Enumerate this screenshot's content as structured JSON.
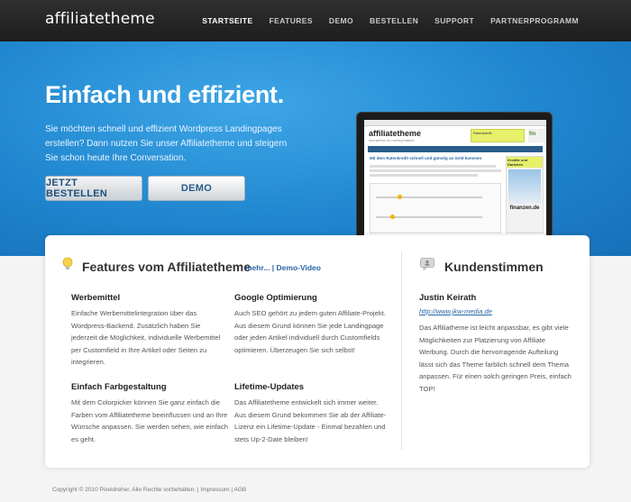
{
  "header": {
    "logo": "affiliatetheme",
    "nav": [
      "STARTSEITE",
      "FEATURES",
      "DEMO",
      "BESTELLEN",
      "SUPPORT",
      "PARTNERPROGRAMM"
    ]
  },
  "hero": {
    "title": "Einfach und effizient.",
    "text": "Sie möchten schnell und effizient Wordpress Landingpages erstellen? Dann nutzen Sie unser Affiliatetheme und steigern Sie schon heute Ihre Conversation.",
    "btn_order": "JETZT BESTELLEN",
    "btn_demo": "DEMO"
  },
  "laptop_screen": {
    "logo": "affiliatetheme",
    "sub": "wordpress for moneymakers",
    "ad": "Ratenkredit",
    "ad2": "fin",
    "headline": "Mit dem Ratenkredit schnell und günstig an Geld kommen",
    "side_header": "Kredite und Darlehen",
    "side_logo": "finanzen.de"
  },
  "features": {
    "title": "Features vom Affiliatetheme",
    "more_link": "mehr...",
    "separator": " | ",
    "demo_link": "Demo-Video",
    "items": [
      {
        "title": "Werbemittel",
        "text": "Einfache Werbemittelintegration über das Wordpress-Backend. Zusätzlich haben Sie jederzeit die Möglichkeit, individuelle Werbemittel per Customfield in Ihre Artikel oder Seiten zu integrieren."
      },
      {
        "title": "Google Optimierung",
        "text": "Auch SEO gehört zu jedem guten Affiliate-Projekt. Aus diesem Grund können Sie jede Landingpage oder jeden Artikel individuell durch Customfields optimieren. Überzeugen Sie sich selbst!"
      },
      {
        "title": "Einfach Farbgestaltung",
        "text": "Mit dem Colorpicker können Sie ganz einfach die Farben vom Affiliatetheme beeinflussen und an Ihre Wünsche anpassen. Sie werden sehen, wie einfach es geht."
      },
      {
        "title": "Lifetime-Updates",
        "text": "Das Affiliatetheme entwickelt sich immer weiter. Aus diesem Grund bekommen Sie ab der Affiliate-Lizenz ein Lifetime-Update - Einmal bezahlen und stets Up-2-Date bleiben!"
      }
    ]
  },
  "testimonials": {
    "title": "Kundenstimmen",
    "name": "Justin Keirath",
    "url": "http://www.jkw-media.de",
    "text": "Das Affiliatheme ist leicht anpassbar, es gibt viele Möglichkeiten zur Platzierung von Affiliate Werbung. Durch die hervorragende Aufteilung lässt sich das Theme farblich schnell dem Thema anpassen. Für einen solch geringen Preis, einfach TOP!"
  },
  "footer": {
    "copyright": "Copyright © 2010 Pixeldreher. Alle Rechte vorbehalten. | ",
    "impressum": "Impressum",
    "sep": " | ",
    "agb": "AGB"
  },
  "colors": {
    "hero_blue": "#1f86cf",
    "link_blue": "#2a66a8",
    "nav_bg": "#1d1d1d"
  }
}
